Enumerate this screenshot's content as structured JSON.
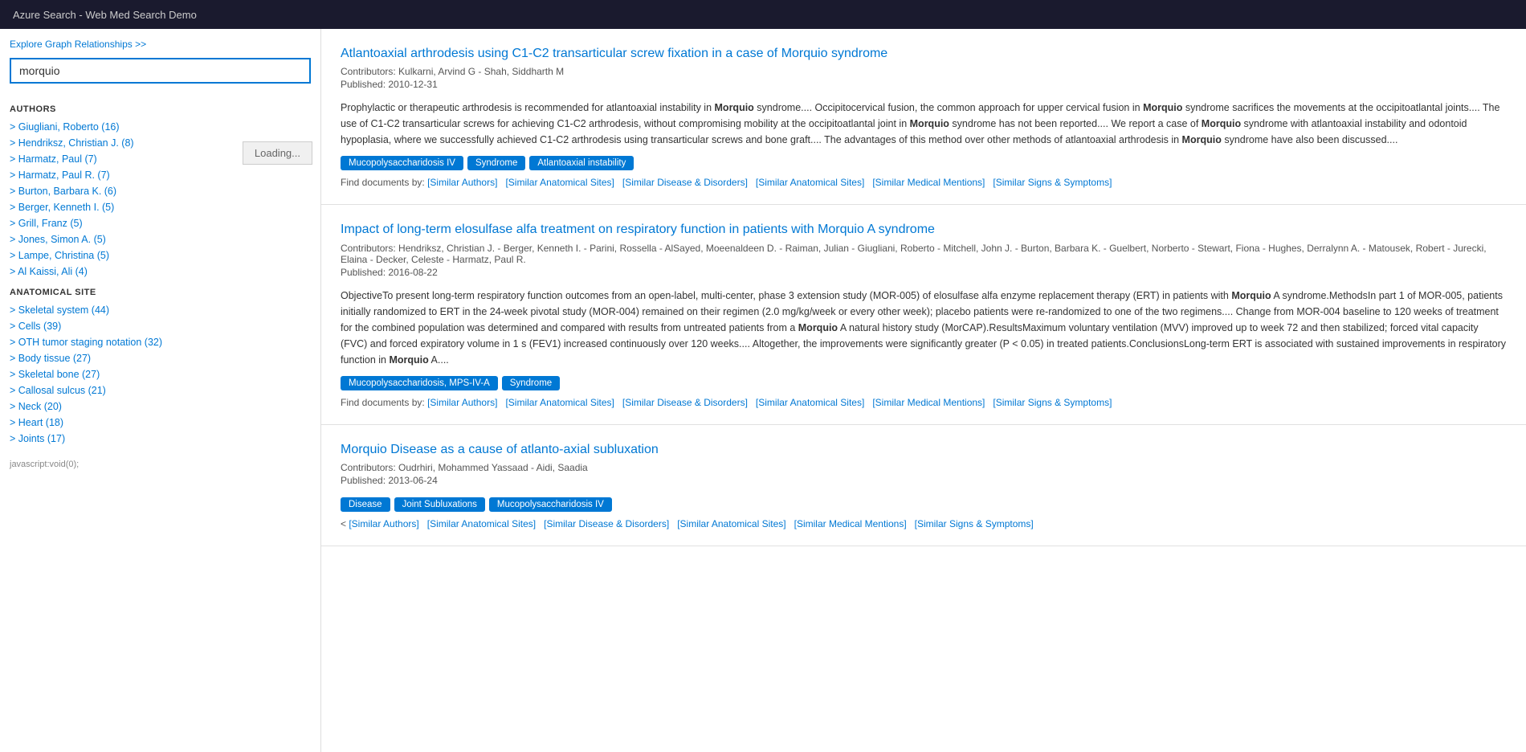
{
  "topbar": {
    "title": "Azure Search - Web Med Search Demo"
  },
  "sidebar": {
    "explore_link": "Explore Graph Relationships >>",
    "search_value": "morquio",
    "search_placeholder": "",
    "loading_text": "Loading...",
    "sections": [
      {
        "title": "AUTHORS",
        "items": [
          "> Giugliani, Roberto (16)",
          "> Hendriksz, Christian J. (8)",
          "> Harmatz, Paul (7)",
          "> Harmatz, Paul R. (7)",
          "> Burton, Barbara K. (6)",
          "> Berger, Kenneth I. (5)",
          "> Grill, Franz (5)",
          "> Jones, Simon A. (5)",
          "> Lampe, Christina (5)",
          "> Al Kaissi, Ali (4)"
        ]
      },
      {
        "title": "ANATOMICAL SITE",
        "items": [
          "> Skeletal system (44)",
          "> Cells (39)",
          "> OTH tumor staging notation (32)",
          "> Body tissue (27)",
          "> Skeletal bone (27)",
          "> Callosal sulcus (21)",
          "> Neck (20)",
          "> Heart (18)",
          "> Joints (17)"
        ]
      }
    ]
  },
  "results": [
    {
      "title": "Atlantoaxial arthrodesis using C1-C2 transarticular screw fixation in a case of Morquio syndrome",
      "contributors": "Contributors: Kulkarni, Arvind G - Shah, Siddharth M",
      "published": "Published: 2010-12-31",
      "abstract": "Prophylactic or therapeutic arthrodesis is recommended for atlantoaxial instability in <b>Morquio</b> syndrome.... Occipitocervical fusion, the common approach for upper cervical fusion in <b>Morquio</b> syndrome sacrifices the movements at the occipitoatlantal joints.... The use of C1-C2 transarticular screws for achieving C1-C2 arthrodesis, without compromising mobility at the occipitoatlantal joint in <b>Morquio</b> syndrome has not been reported.... We report a case of <b>Morquio</b> syndrome with atlantoaxial instability and odontoid hypoplasia, where we successfully achieved C1-C2 arthrodesis using transarticular screws and bone graft.... The advantages of this method over other methods of atlantoaxial arthrodesis in <b>Morquio</b> syndrome have also been discussed....",
      "tags": [
        {
          "label": "Mucopolysaccharidosis IV",
          "color": "tag-blue"
        },
        {
          "label": "Syndrome",
          "color": "tag-blue"
        },
        {
          "label": "Atlantoaxial instability",
          "color": "tag-blue"
        }
      ],
      "find_docs": "Find documents by: [Similar Authors]   [Similar Anatomical Sites]   [Similar Disease & Disorders]   [Similar Anatomical Sites]   [Similar Medical Mentions]   [Similar Signs & Symptoms]"
    },
    {
      "title": "Impact of long-term elosulfase alfa treatment on respiratory function in patients with Morquio A syndrome",
      "contributors": "Contributors: Hendriksz, Christian J. - Berger, Kenneth I. - Parini, Rossella - AlSayed, Moeenaldeen D. - Raiman, Julian - Giugliani, Roberto - Mitchell, John J. - Burton, Barbara K. - Guelbert, Norberto - Stewart, Fiona - Hughes, Derralynn A. - Matousek, Robert - Jurecki, Elaina - Decker, Celeste - Harmatz, Paul R.",
      "published": "Published: 2016-08-22",
      "abstract": "ObjectiveTo present long-term respiratory function outcomes from an open-label, multi-center, phase 3 extension study (MOR-005) of elosulfase alfa enzyme replacement therapy (ERT) in patients with <b>Morquio</b> A syndrome.MethodsIn part 1 of MOR-005, patients initially randomized to ERT in the 24-week pivotal study (MOR-004) remained on their regimen (2.0 mg/kg/week or every other week); placebo patients were re-randomized to one of the two regimens.... Change from MOR-004 baseline to 120 weeks of treatment for the combined population was determined and compared with results from untreated patients from a <b>Morquio</b> A natural history study (MorCAP).ResultsMaximum voluntary ventilation (MVV) improved up to week 72 and then stabilized; forced vital capacity (FVC) and forced expiratory volume in 1 s (FEV1) increased continuously over 120 weeks.... Altogether, the improvements were significantly greater (P < 0.05) in treated patients.ConclusionsLong-term ERT is associated with sustained improvements in respiratory function in <b>Morquio</b> A....",
      "tags": [
        {
          "label": "Mucopolysaccharidosis, MPS-IV-A",
          "color": "tag-blue"
        },
        {
          "label": "Syndrome",
          "color": "tag-blue"
        }
      ],
      "find_docs": "Find documents by: [Similar Authors]   [Similar Anatomical Sites]   [Similar Disease & Disorders]   [Similar Anatomical Sites]   [Similar Medical Mentions]   [Similar Signs & Symptoms]"
    },
    {
      "title": "Morquio Disease as a cause of atlanto-axial subluxation",
      "contributors": "Contributors: Oudrhiri, Mohammed Yassaad - Aidi, Saadia",
      "published": "Published: 2013-06-24",
      "abstract": "",
      "tags": [
        {
          "label": "Disease",
          "color": "tag-blue"
        },
        {
          "label": "Joint Subluxations",
          "color": "tag-blue"
        },
        {
          "label": "Mucopolysaccharidosis IV",
          "color": "tag-blue"
        }
      ],
      "find_docs": "< [Similar Authors]   [Similar Anatomical Sites]   [Similar Disease & Disorders]   [Similar Anatomical Sites]   [Similar Medical Mentions]   [Similar Signs & Symptoms]"
    }
  ],
  "footer": {
    "text": "javascript:void(0);"
  }
}
